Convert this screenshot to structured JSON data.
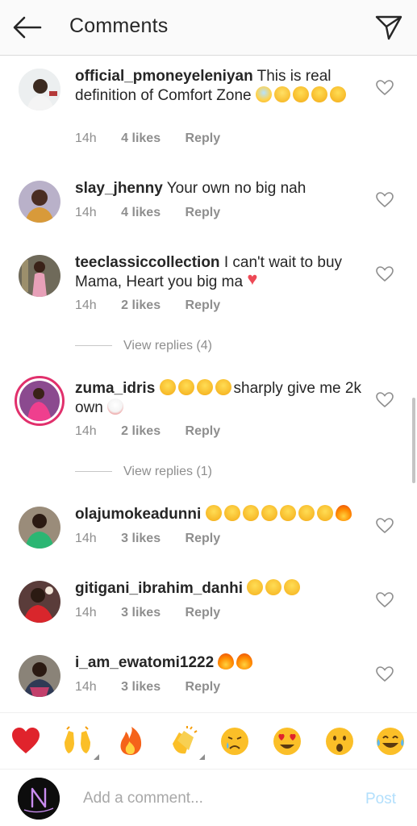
{
  "header": {
    "title": "Comments",
    "back_icon": "arrow-left-icon",
    "share_icon": "paper-plane-icon"
  },
  "comments": [
    {
      "username": "official_pmoneyeleniyan",
      "text": "This is real definition of Comfort Zone",
      "emojis": [
        "face-screaming-in-fear",
        "flushed-face",
        "rolling-on-floor-laughing",
        "rolling-on-floor-laughing",
        "rolling-on-floor-laughing"
      ],
      "time": "14h",
      "likes": "4 likes",
      "reply": "Reply"
    },
    {
      "username": "slay_jhenny",
      "text": "Your own no big nah",
      "emojis": [],
      "time": "14h",
      "likes": "4 likes",
      "reply": "Reply"
    },
    {
      "username": "teeclassiccollection",
      "text": "I can't wait to buy Mama, Heart you big ma",
      "emojis": [
        "red-heart"
      ],
      "time": "14h",
      "likes": "2 likes",
      "reply": "Reply",
      "view_replies": "View replies (4)"
    },
    {
      "username": "zuma_idris",
      "text": "sharply give me 2k own",
      "emojis": [
        "face-with-tears-of-joy",
        "face-with-tears-of-joy",
        "face-with-tears-of-joy",
        "face-with-tears-of-joy",
        "clown-face"
      ],
      "time": "14h",
      "likes": "2 likes",
      "reply": "Reply",
      "view_replies": "View replies (1)"
    },
    {
      "username": "olajumokeadunni",
      "text": "",
      "emojis": [
        "face-with-tears-of-joy",
        "face-with-tears-of-joy",
        "face-with-tears-of-joy",
        "face-with-tears-of-joy",
        "face-with-tears-of-joy",
        "face-with-tears-of-joy",
        "face-with-tears-of-joy",
        "fire"
      ],
      "time": "14h",
      "likes": "3 likes",
      "reply": "Reply"
    },
    {
      "username": "gitigani_ibrahim_danhi",
      "text": "",
      "emojis": [
        "smiling-face-with-heart-eyes",
        "smiling-face-with-heart-eyes",
        "smiling-face-with-heart-eyes"
      ],
      "time": "14h",
      "likes": "3 likes",
      "reply": "Reply"
    },
    {
      "username": "i_am_ewatomi1222",
      "text": "",
      "emojis": [
        "fire",
        "fire"
      ],
      "time": "14h",
      "likes": "3 likes",
      "reply": "Reply"
    }
  ],
  "reactions": [
    "red-heart-icon",
    "raising-hands-icon",
    "fire-icon",
    "clapping-hands-icon",
    "crying-face-icon",
    "heart-eyes-icon",
    "surprised-face-icon",
    "tears-of-joy-icon"
  ],
  "composer": {
    "placeholder": "Add a comment...",
    "post_label": "Post"
  },
  "colors": {
    "accent": "#0095f6",
    "post_disabled": "#b2dffc",
    "like_heart": "#ed4956",
    "story_ring": "#e1306c"
  }
}
